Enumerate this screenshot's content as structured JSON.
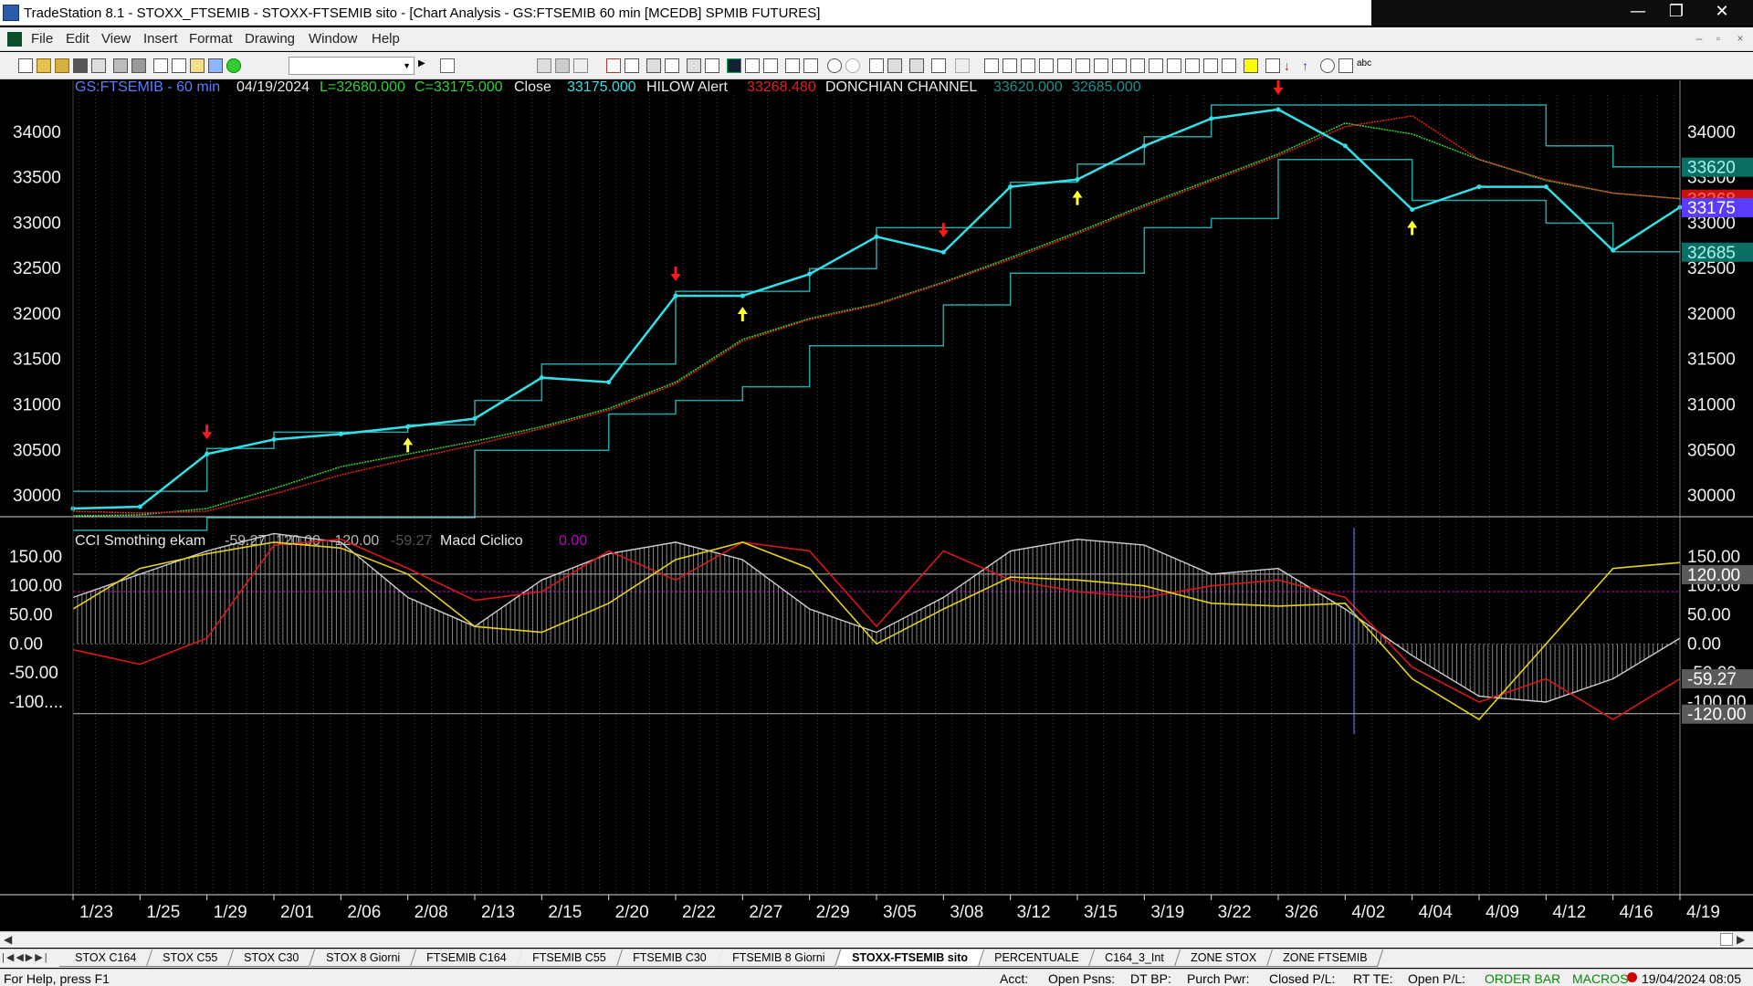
{
  "window": {
    "title": "TradeStation 8.1 - STOXX_FTSEMIB - STOXX-FTSEMIB sito - [Chart Analysis - GS:FTSEMIB  60 min  [MCEDB] SPMIB FUTURES]",
    "controls": [
      "—",
      "❐",
      "✕"
    ]
  },
  "menu": {
    "items": [
      "File",
      "Edit",
      "View",
      "Insert",
      "Format",
      "Drawing",
      "Window",
      "Help"
    ],
    "mdi_controls": [
      "–",
      "▫",
      "×"
    ]
  },
  "toolbar": {
    "dropdown_value": ""
  },
  "price_header": {
    "symbol": "GS:FTSEMIB - 60 min",
    "date": "04/19/2024",
    "low": "L=32680.000",
    "close": "C=33175.000",
    "close_label": "Close",
    "close_value": "33175.000",
    "hilow_label": "HILOW Alert",
    "hilow_value": "33268.480",
    "donchian_label": "DONCHIAN CHANNEL",
    "donchian_upper": "33620.000",
    "donchian_lower": "32685.000"
  },
  "price_axis": {
    "labels": [
      "34000",
      "33500",
      "33000",
      "32500",
      "32000",
      "31500",
      "31000",
      "30500",
      "30000"
    ],
    "right_labels": [
      "34000",
      "33500",
      "33000",
      "32500",
      "32000",
      "31500",
      "31000",
      "30500",
      "30000"
    ],
    "badges": {
      "upper": "33620",
      "hilow": "33268",
      "close": "33175",
      "lower": "32685"
    }
  },
  "indicator_header": {
    "cci_label": "CCI Smothing ekam",
    "cci_value": "-59.27",
    "cci_up": "120.00",
    "cci_down": "-120.00",
    "cci_value2": "-59.27",
    "macd_label": "Macd Ciclico",
    "macd_value": "0.00"
  },
  "indicator_axis": {
    "labels": [
      "150.00",
      "100.00",
      "50.00",
      "0.00",
      "-50.00",
      "-100...."
    ],
    "right_labels": [
      "150.00",
      "100.00",
      "50.00",
      "0.00",
      "-50.00",
      "-100.00"
    ],
    "badges": {
      "upper": "120.00",
      "value": "-59.27",
      "lower": "-120.00"
    }
  },
  "date_axis": {
    "labels": [
      "1/23",
      "1/25",
      "1/29",
      "2/01",
      "2/06",
      "2/08",
      "2/13",
      "2/15",
      "2/20",
      "2/22",
      "2/27",
      "2/29",
      "3/05",
      "3/08",
      "3/12",
      "3/15",
      "3/19",
      "3/22",
      "3/26",
      "4/02",
      "4/04",
      "4/09",
      "4/12",
      "4/16",
      "4/19"
    ]
  },
  "colors": {
    "price": "#33e0e8",
    "donchian": "#2aa5a5",
    "ma": "#35d135",
    "hilow": "#e02020",
    "cci_hist": "#9a9a9a",
    "red_line": "#d81818",
    "yellow_line": "#e6d21a",
    "magenta": "#c000c0"
  },
  "chart_data": {
    "type": "line",
    "title": "GS:FTSEMIB - 60 min",
    "x": [
      "1/23",
      "1/25",
      "1/29",
      "2/01",
      "2/06",
      "2/08",
      "2/13",
      "2/15",
      "2/20",
      "2/22",
      "2/27",
      "2/29",
      "3/05",
      "3/08",
      "3/12",
      "3/15",
      "3/19",
      "3/22",
      "3/26",
      "4/02",
      "4/04",
      "4/09",
      "4/12",
      "4/16",
      "4/19"
    ],
    "series": [
      {
        "values": [
          29860,
          29880,
          30460,
          30620,
          30680,
          30760,
          30850,
          31300,
          31250,
          32200,
          32200,
          32440,
          32850,
          32680,
          33400,
          33480,
          33850,
          34150,
          34250,
          33850,
          33150,
          33400,
          33400,
          32700,
          33175
        ]
      },
      {
        "values": [
          30050,
          30050,
          30520,
          30700,
          30700,
          30780,
          31050,
          31450,
          31450,
          32250,
          32250,
          32500,
          32950,
          32950,
          33450,
          33650,
          33950,
          34300,
          34300,
          34300,
          34300,
          34300,
          33850,
          33620,
          33620
        ]
      },
      {
        "values": [
          29620,
          29620,
          29760,
          29760,
          29760,
          29760,
          30500,
          30500,
          30900,
          31050,
          31200,
          31650,
          31650,
          32100,
          32450,
          32450,
          32950,
          33050,
          33700,
          33700,
          33250,
          33250,
          33000,
          32685,
          32685
        ]
      },
      {
        "values": [
          29780,
          29790,
          29860,
          30080,
          30320,
          30460,
          30600,
          30760,
          30960,
          31250,
          31720,
          31950,
          32110,
          32350,
          32620,
          32900,
          33200,
          33480,
          33760,
          34100,
          33980,
          33700,
          33470,
          33330,
          33268
        ]
      },
      {
        "values": [
          29830,
          29810,
          29830,
          30020,
          30230,
          30400,
          30560,
          30740,
          30940,
          31230,
          31700,
          31940,
          32100,
          32340,
          32600,
          32880,
          33180,
          33460,
          33740,
          34060,
          34180,
          33700,
          33480,
          33330,
          33268
        ]
      }
    ],
    "ylim": [
      29770,
      34410
    ],
    "signals_down": [
      "1/29",
      "2/22",
      "3/08",
      "3/26"
    ],
    "signals_up": [
      "2/08",
      "2/27",
      "3/15",
      "4/04"
    ],
    "panels": [
      {
        "type": "line",
        "title": "CCI Smothing ekam",
        "x": [
          "1/23",
          "1/25",
          "1/29",
          "2/01",
          "2/06",
          "2/08",
          "2/13",
          "2/15",
          "2/20",
          "2/22",
          "2/27",
          "2/29",
          "3/05",
          "3/08",
          "3/12",
          "3/15",
          "3/19",
          "3/22",
          "3/26",
          "4/02",
          "4/04",
          "4/09",
          "4/12",
          "4/16",
          "4/19"
        ],
        "series": [
          {
            "values": [
              80,
              120,
              160,
              190,
              175,
              80,
              30,
              110,
              155,
              175,
              145,
              60,
              20,
              80,
              160,
              180,
              170,
              120,
              130,
              60,
              -20,
              -90,
              -100,
              -60,
              10
            ]
          },
          {
            "values": [
              -10,
              -35,
              10,
              170,
              180,
              130,
              75,
              90,
              160,
              110,
              175,
              160,
              30,
              160,
              110,
              90,
              80,
              100,
              110,
              80,
              -40,
              -100,
              -60,
              -130,
              -60
            ]
          },
          {
            "values": [
              60,
              130,
              155,
              175,
              165,
              120,
              30,
              20,
              70,
              145,
              175,
              130,
              0,
              60,
              115,
              110,
              100,
              70,
              65,
              70,
              -60,
              -130,
              0,
              130,
              140
            ]
          }
        ],
        "ylim": [
          -155,
          200
        ],
        "levels": [
          120,
          90,
          0,
          -120
        ]
      }
    ]
  }
}
